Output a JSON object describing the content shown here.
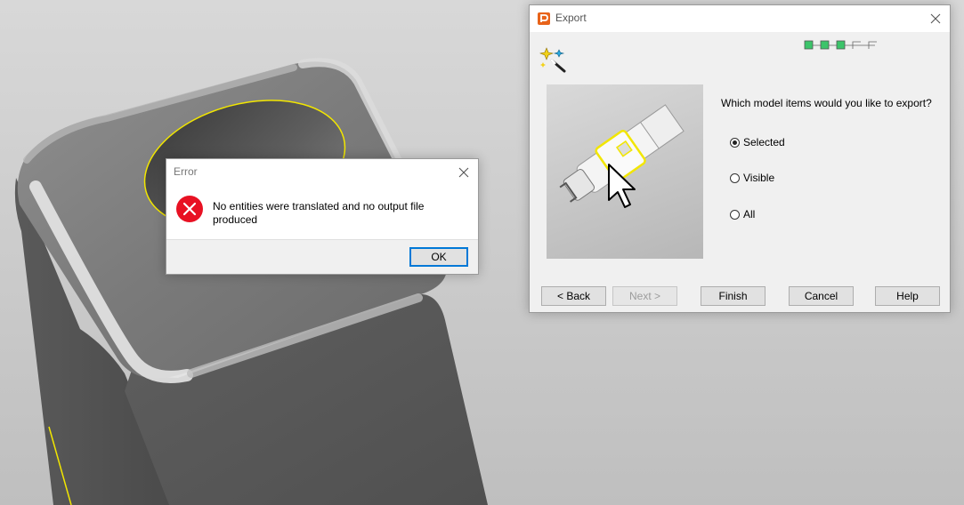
{
  "error_dialog": {
    "title": "Error",
    "message": "No entities were translated and no output file produced",
    "ok_label": "OK"
  },
  "export_dialog": {
    "title": "Export",
    "question": "Which model items would you like to export?",
    "options": [
      {
        "label": "Selected",
        "checked": true
      },
      {
        "label": "Visible",
        "checked": false
      },
      {
        "label": "All",
        "checked": false
      }
    ],
    "buttons": {
      "back": "< Back",
      "next": "Next >",
      "finish": "Finish",
      "cancel": "Cancel",
      "help": "Help"
    },
    "wizard_steps": {
      "total": 5,
      "completed": 3
    }
  },
  "colors": {
    "error_red": "#e81123",
    "highlight_yellow": "#f2e600",
    "step_green": "#3cc46a",
    "default_button_blue": "#0078d7",
    "app_icon_orange": "#e8631a"
  },
  "icons": {
    "error": "error-icon",
    "close": "close-icon",
    "wizard": "magic-wand-icon",
    "app": "app-logo-icon"
  }
}
